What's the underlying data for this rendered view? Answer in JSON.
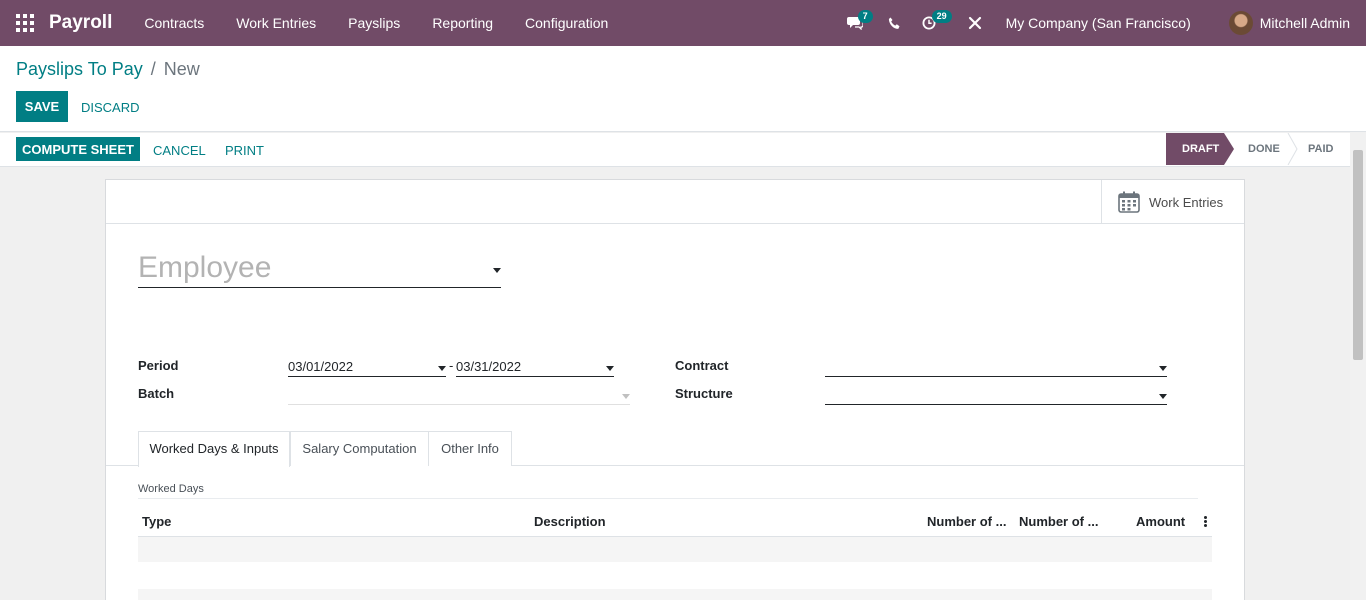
{
  "navbar": {
    "app_name": "Payroll",
    "menu": [
      "Contracts",
      "Work Entries",
      "Payslips",
      "Reporting",
      "Configuration"
    ],
    "messages_count": "7",
    "activities_count": "29",
    "company": "My Company (San Francisco)",
    "user": "Mitchell Admin"
  },
  "breadcrumb": {
    "parent": "Payslips To Pay",
    "separator": "/",
    "current": "New"
  },
  "actions": {
    "save": "SAVE",
    "discard": "DISCARD"
  },
  "statusbar": {
    "buttons": {
      "compute": "COMPUTE SHEET",
      "cancel": "CANCEL",
      "print": "PRINT"
    },
    "stages": [
      "DRAFT",
      "DONE",
      "PAID"
    ],
    "active_stage": "DRAFT"
  },
  "smart_button": {
    "label": "Work Entries",
    "icon": "calendar-icon"
  },
  "form": {
    "employee_placeholder": "Employee",
    "period_label": "Period",
    "period_from": "03/01/2022",
    "period_separator": "-",
    "period_to": "03/31/2022",
    "batch_label": "Batch",
    "batch_value": "",
    "contract_label": "Contract",
    "contract_value": "",
    "structure_label": "Structure",
    "structure_value": ""
  },
  "tabs": [
    "Worked Days & Inputs",
    "Salary Computation",
    "Other Info"
  ],
  "active_tab": "Worked Days & Inputs",
  "worked_days": {
    "title": "Worked Days",
    "columns": [
      "Type",
      "Description",
      "Number of ...",
      "Number of ...",
      "Amount"
    ],
    "rows": []
  },
  "colors": {
    "brand": "#714b67",
    "accent": "#017e84"
  }
}
